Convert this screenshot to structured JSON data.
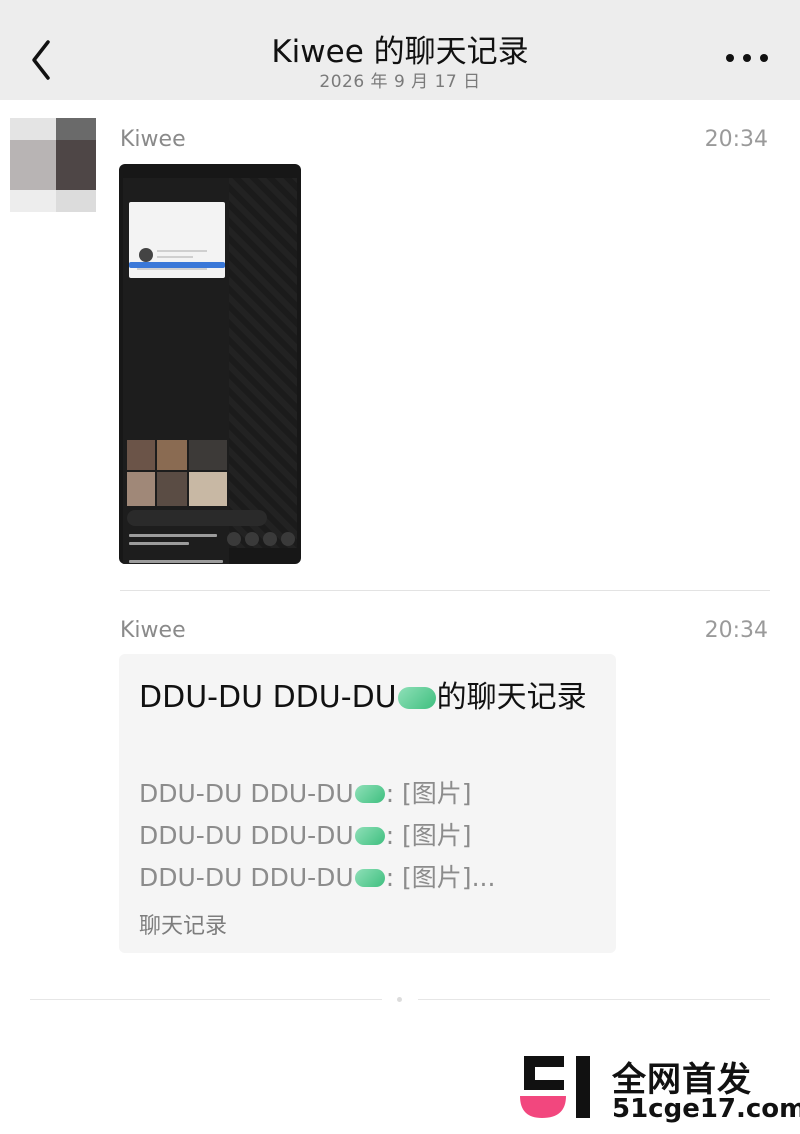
{
  "header": {
    "title": "Kiwee 的聊天记录",
    "date": "2026 年 9 月 17 日"
  },
  "messages": [
    {
      "sender": "Kiwee",
      "time": "20:34",
      "type": "image"
    },
    {
      "sender": "Kiwee",
      "time": "20:34",
      "type": "chat-record",
      "card": {
        "title_part1": "DDU-DU DDU-DU",
        "title_part2": "的聊天记录",
        "lines": [
          {
            "name": "DDU-DU DDU-DU",
            "text": ": [图片]"
          },
          {
            "name": "DDU-DU DDU-DU",
            "text": ": [图片]"
          },
          {
            "name": "DDU-DU DDU-DU",
            "text": ": [图片]..."
          }
        ],
        "footer": "聊天记录"
      }
    }
  ],
  "watermark": {
    "top_text": "全网首发",
    "bottom_text": "51cge17.com"
  },
  "colors": {
    "header_bg": "#ededed",
    "card_bg": "#f5f5f5",
    "emoji_green": "#3fbf7f",
    "logo_pink": "#f2477e"
  }
}
